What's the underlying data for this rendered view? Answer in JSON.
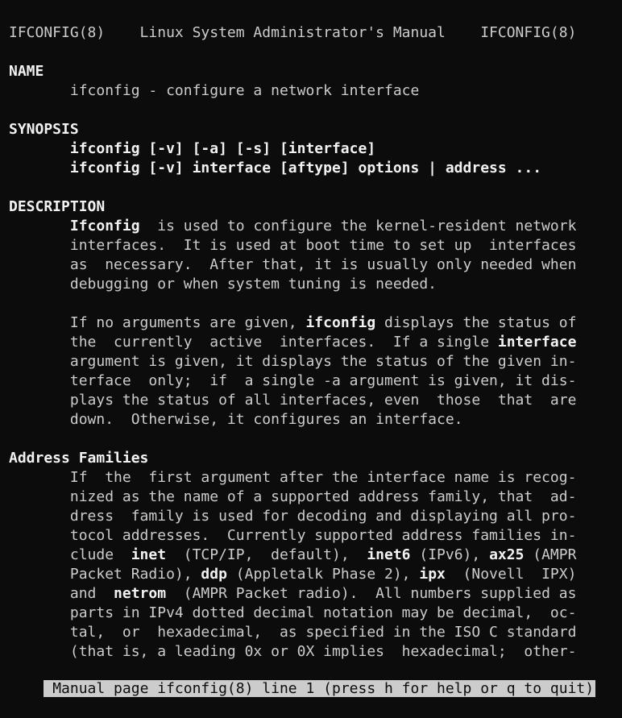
{
  "terminal": {
    "lines": [
      [
        {
          "t": "IFCONFIG(8)    Linux System Administrator's Manual    IFCONFIG(8)"
        }
      ],
      [],
      [
        {
          "t": "NAME",
          "b": true
        }
      ],
      [
        {
          "t": "       ifconfig - configure a network interface"
        }
      ],
      [],
      [
        {
          "t": "SYNOPSIS",
          "b": true
        }
      ],
      [
        {
          "t": "       "
        },
        {
          "t": "ifconfig [-v] [-a] [-s] [interface]",
          "b": true
        }
      ],
      [
        {
          "t": "       "
        },
        {
          "t": "ifconfig [-v] interface [aftype] options | address ...",
          "b": true
        }
      ],
      [],
      [
        {
          "t": "DESCRIPTION",
          "b": true
        }
      ],
      [
        {
          "t": "       "
        },
        {
          "t": "Ifconfig",
          "b": true
        },
        {
          "t": "  is used to configure the kernel-resident network"
        }
      ],
      [
        {
          "t": "       interfaces.  It is used at boot time to set up  interfaces"
        }
      ],
      [
        {
          "t": "       as  necessary.  After that, it is usually only needed when"
        }
      ],
      [
        {
          "t": "       debugging or when system tuning is needed."
        }
      ],
      [],
      [
        {
          "t": "       If no arguments are given, "
        },
        {
          "t": "ifconfig",
          "b": true
        },
        {
          "t": " displays the status of"
        }
      ],
      [
        {
          "t": "       the  currently  active  interfaces.  If a single "
        },
        {
          "t": "interface",
          "b": true
        }
      ],
      [
        {
          "t": "       argument is given, it displays the status of the given in-"
        }
      ],
      [
        {
          "t": "       terface  only;  if  a single -a argument is given, it dis-"
        }
      ],
      [
        {
          "t": "       plays the status of all interfaces, even  those  that  are"
        }
      ],
      [
        {
          "t": "       down.  Otherwise, it configures an interface."
        }
      ],
      [],
      [
        {
          "t": "Address Families",
          "b": true
        }
      ],
      [
        {
          "t": "       If  the  first argument after the interface name is recog-"
        }
      ],
      [
        {
          "t": "       nized as the name of a supported address family, that  ad-"
        }
      ],
      [
        {
          "t": "       dress  family is used for decoding and displaying all pro-"
        }
      ],
      [
        {
          "t": "       tocol addresses.  Currently supported address families in-"
        }
      ],
      [
        {
          "t": "       clude  "
        },
        {
          "t": "inet",
          "b": true
        },
        {
          "t": "  (TCP/IP,  default),  "
        },
        {
          "t": "inet6",
          "b": true
        },
        {
          "t": " (IPv6), "
        },
        {
          "t": "ax25",
          "b": true
        },
        {
          "t": " (AMPR"
        }
      ],
      [
        {
          "t": "       Packet Radio), "
        },
        {
          "t": "ddp",
          "b": true
        },
        {
          "t": " (Appletalk Phase 2), "
        },
        {
          "t": "ipx",
          "b": true
        },
        {
          "t": "  (Novell  IPX)"
        }
      ],
      [
        {
          "t": "       and  "
        },
        {
          "t": "netrom",
          "b": true
        },
        {
          "t": "  (AMPR Packet radio).  All numbers supplied as"
        }
      ],
      [
        {
          "t": "       parts in IPv4 dotted decimal notation may be decimal,  oc-"
        }
      ],
      [
        {
          "t": "       tal,  or  hexadecimal,  as specified in the ISO C standard"
        }
      ],
      [
        {
          "t": "       (that is, a leading 0x or 0X implies  hexadecimal;  other-"
        }
      ]
    ],
    "status": " Manual page ifconfig(8) line 1 (press h for help or q to quit)"
  }
}
